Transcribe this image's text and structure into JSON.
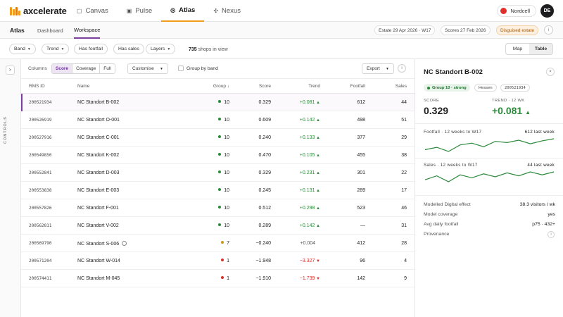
{
  "app": {
    "logo_text": "axcelerate"
  },
  "nav": [
    {
      "label": "Canvas",
      "icon": "canvas-icon"
    },
    {
      "label": "Pulse",
      "icon": "pulse-icon"
    },
    {
      "label": "Atlas",
      "icon": "compass-icon",
      "active": true
    },
    {
      "label": "Nexus",
      "icon": "nexus-icon"
    }
  ],
  "org": {
    "name": "Nordcell",
    "color": "#e0302e"
  },
  "user": {
    "initials": "DE"
  },
  "subnav": {
    "title": "Atlas",
    "tabs": [
      {
        "label": "Dashboard"
      },
      {
        "label": "Workspace",
        "active": true
      }
    ],
    "estate_chip": "Estate 29 Apr 2026 · W17",
    "scores_chip": "Scores 27 Feb 2026",
    "disguised_chip": "Disguised estate",
    "info": "i"
  },
  "filters": [
    {
      "label": "Band",
      "caret": true
    },
    {
      "label": "Trend",
      "caret": true
    },
    {
      "label": "Has footfall"
    },
    {
      "label": "Has sales"
    },
    {
      "label": "Layers",
      "caret": true
    }
  ],
  "shops": {
    "count": "735",
    "suffix": "shops in view"
  },
  "view_toggle": [
    "Map",
    "Table"
  ],
  "rail": {
    "toggle": ">",
    "label": "CONTROLS"
  },
  "toolbar": {
    "columns_label": "Columns",
    "column_modes": [
      "Score",
      "Coverage",
      "Full"
    ],
    "customise": "Customise",
    "group_by": "Group by band",
    "export": "Export",
    "info": "i"
  },
  "table": {
    "headers": {
      "id": "RMS ID",
      "name": "Name",
      "group": "Group ↓",
      "score": "Score",
      "trend": "Trend",
      "footfall": "Footfall",
      "sales": "Sales"
    },
    "rows": [
      {
        "id": "200521934",
        "name": "NC Standort B-002",
        "group": "10",
        "score": "0.329",
        "trend": "+0.081",
        "dir": "up",
        "footfall": "612",
        "sales": "44",
        "selected": true
      },
      {
        "id": "200526919",
        "name": "NC Standort O-001",
        "group": "10",
        "score": "0.609",
        "trend": "+0.142",
        "dir": "up",
        "footfall": "498",
        "sales": "51"
      },
      {
        "id": "200527916",
        "name": "NC Standort C-001",
        "group": "10",
        "score": "0.240",
        "trend": "+0.133",
        "dir": "up",
        "footfall": "377",
        "sales": "29"
      },
      {
        "id": "200549850",
        "name": "NC Standort K-002",
        "group": "10",
        "score": "0.470",
        "trend": "+0.105",
        "dir": "up",
        "footfall": "455",
        "sales": "38"
      },
      {
        "id": "200552841",
        "name": "NC Standort D-003",
        "group": "10",
        "score": "0.329",
        "trend": "+0.231",
        "dir": "up",
        "footfall": "301",
        "sales": "22"
      },
      {
        "id": "200553838",
        "name": "NC Standort E-003",
        "group": "10",
        "score": "0.245",
        "trend": "+0.131",
        "dir": "up",
        "footfall": "289",
        "sales": "17"
      },
      {
        "id": "200557826",
        "name": "NC Standort F-001",
        "group": "10",
        "score": "0.512",
        "trend": "+0.298",
        "dir": "up",
        "footfall": "523",
        "sales": "46"
      },
      {
        "id": "200562811",
        "name": "NC Standort V-002",
        "group": "10",
        "score": "0.289",
        "trend": "+0.142",
        "dir": "up",
        "footfall": "—",
        "sales": "31"
      },
      {
        "id": "200569790",
        "name": "NC Standort S-006",
        "group": "7",
        "score": "−0.240",
        "trend": "+0.004",
        "dir": "flat",
        "footfall": "412",
        "sales": "28",
        "ring": true
      },
      {
        "id": "200571204",
        "name": "NC Standort W-014",
        "group": "1",
        "score": "−1.948",
        "trend": "−3.327",
        "dir": "down",
        "footfall": "96",
        "sales": "4"
      },
      {
        "id": "200574411",
        "name": "NC Standort M-045",
        "group": "1",
        "score": "−1.910",
        "trend": "−1.739",
        "dir": "down",
        "footfall": "142",
        "sales": "9"
      }
    ]
  },
  "group_colors": {
    "10": "#2c8a3c",
    "7": "#c99a1e",
    "1": "#d6302c"
  },
  "panel": {
    "title": "NC Standort B-002",
    "close": "×",
    "group_badge": "Group 10 · strong",
    "region_badge": "Hessen",
    "id_badge": "200521934",
    "score_label": "SCORE",
    "score_value": "0.329",
    "trend_label": "TREND · 12 WK",
    "trend_value": "+0.081",
    "footfall_title": "Footfall · 12 weeks to W17",
    "footfall_last": "612 last week",
    "footfall_series": [
      520,
      540,
      505,
      560,
      575,
      545,
      590,
      580,
      600,
      570,
      595,
      612
    ],
    "sales_title": "Sales · 12 weeks to W17",
    "sales_last": "44 last week",
    "sales_series": [
      36,
      40,
      34,
      41,
      38,
      42,
      39,
      43,
      40,
      44,
      41,
      44
    ],
    "details": [
      {
        "label": "Modelled Digital effect",
        "value": "38.3 visitors / wk"
      },
      {
        "label": "Model coverage",
        "value": "yes"
      },
      {
        "label": "Avg daily footfall",
        "value": "p75 · 432+"
      }
    ],
    "provenance": "Provenance"
  }
}
